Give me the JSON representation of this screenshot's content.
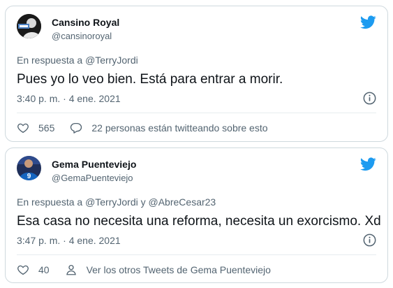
{
  "tweets": [
    {
      "name": "Cansino Royal",
      "handle": "@cansinoroyal",
      "reply_prefix": "En respuesta a",
      "reply_to": "@TerryJordi",
      "text": "Pues yo lo veo bien. Está para entrar a morir.",
      "time": "3:40 p. m. · 4 ene. 2021",
      "likes": "565",
      "secondary_action": "22 personas están twitteando sobre esto",
      "secondary_icon": "reply-bubble-icon"
    },
    {
      "name": "Gema Puenteviejo",
      "handle": "@GemaPuenteviejo",
      "reply_prefix": "En respuesta a",
      "reply_to": "@TerryJordi y @AbreCesar23",
      "text": "Esa casa no necesita una reforma, necesita un exorcismo. Xd",
      "time": "3:47 p. m. · 4 ene. 2021",
      "likes": "40",
      "secondary_action": "Ver los otros Tweets de Gema Puenteviejo",
      "secondary_icon": "person-icon"
    }
  ],
  "colors": {
    "twitter_blue": "#1d9bf0",
    "secondary_text": "#536471",
    "border": "#cfd9de"
  }
}
